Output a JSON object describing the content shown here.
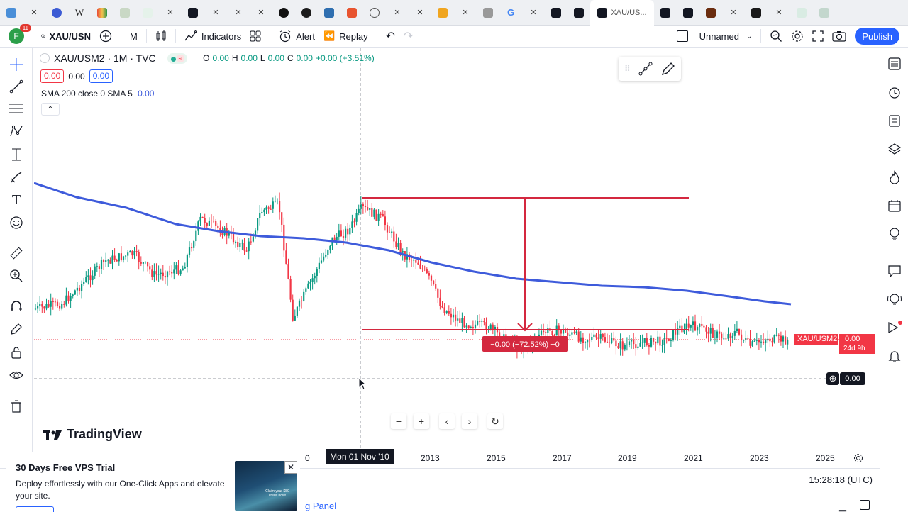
{
  "tabs": {
    "active_title": "XAU/US..."
  },
  "toolbar": {
    "avatar_letter": "F",
    "notif_count": "11",
    "symbol": "XAU/USN",
    "interval": "M",
    "indicators_label": "Indicators",
    "alert_label": "Alert",
    "replay_label": "Replay",
    "layout_name": "Unnamed",
    "publish_label": "Publish"
  },
  "legend": {
    "title": "XAU/USM2 · 1M · TVC",
    "o_label": "O",
    "o_val": "0.00",
    "h_label": "H",
    "h_val": "0.00",
    "l_label": "L",
    "l_val": "0.00",
    "c_label": "C",
    "c_val": "0.00",
    "change": "+0.00 (+3.51%)",
    "bid": "0.00",
    "mid": "0.00",
    "ask": "0.00",
    "sma_text": "SMA 200 close 0 SMA 5",
    "sma_val": "0.00"
  },
  "chart_labels": {
    "range_label": "−0.00 (−72.52%) −0",
    "symbol_tag": "XAU/USM2",
    "price_tag": "0.00",
    "countdown": "24d 9h",
    "crosshair_price": "0.00",
    "crosshair_date": "Mon 01 Nov '10",
    "partial_year": "0",
    "years": [
      "2013",
      "2015",
      "2017",
      "2019",
      "2021",
      "2023",
      "2025"
    ]
  },
  "brand": "TradingView",
  "status": {
    "clock": "15:28:18 (UTC)",
    "panel_label": "g Panel"
  },
  "ad": {
    "title": "30 Days Free VPS Trial",
    "body": "Deploy effortlessly with our One-Click Apps and elevate your site.",
    "image_text": "Claim your $50 credit now!"
  },
  "colors": {
    "accent": "#2962ff",
    "up": "#089981",
    "down": "#f23645",
    "sma": "#3e5bdb",
    "range": "#d4283f"
  }
}
